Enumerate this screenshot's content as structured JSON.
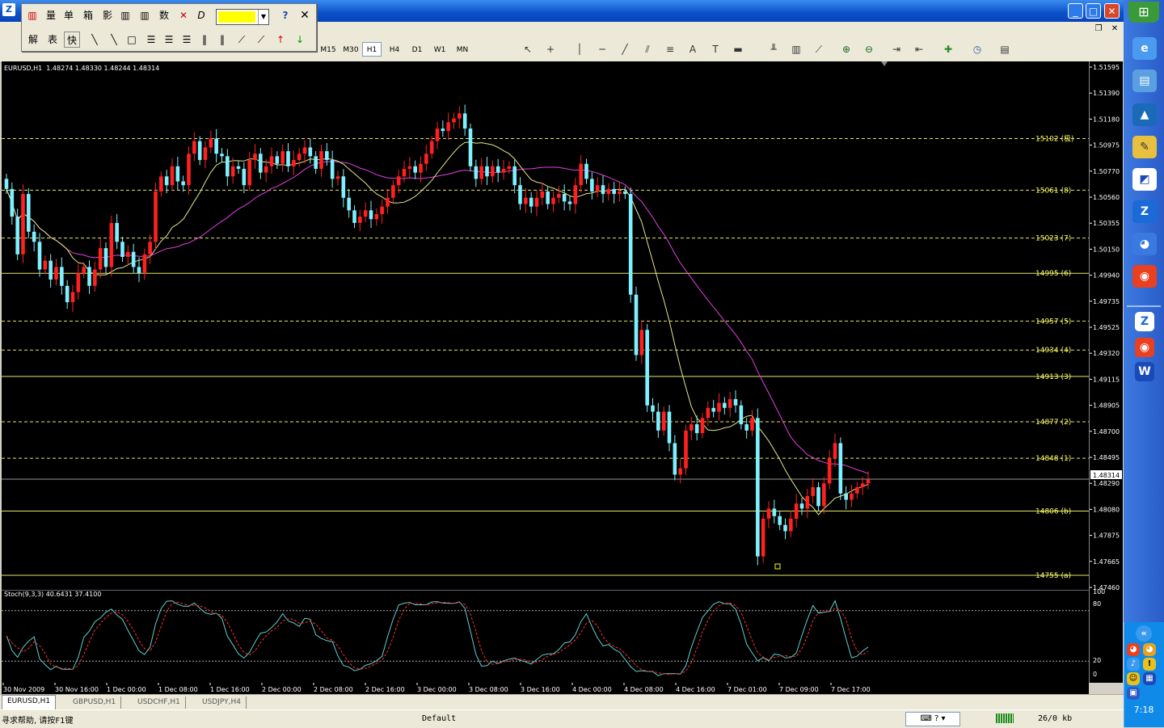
{
  "window": {
    "minimize": "_",
    "maximize": "□",
    "close": "✕",
    "restore_small": "❐",
    "close_small": "✕"
  },
  "float_toolbar": {
    "row1": [
      "量",
      "单",
      "箱",
      "影",
      "数"
    ],
    "row2": [
      "解",
      "表",
      "快"
    ],
    "color_value": ""
  },
  "timeframes": [
    "M15",
    "M30",
    "H1",
    "H4",
    "D1",
    "W1",
    "MN"
  ],
  "active_timeframe": "H1",
  "chart": {
    "header": "EURUSD,H1  1.48274 1.48330 1.48244 1.48314",
    "current_price": "1.48314",
    "price_ticks": [
      "1.51595",
      "1.51390",
      "1.51180",
      "1.50975",
      "1.50770",
      "1.50560",
      "1.50355",
      "1.50150",
      "1.49940",
      "1.49735",
      "1.49525",
      "1.49320",
      "1.49115",
      "1.48905",
      "1.48700",
      "1.48495",
      "1.48290",
      "1.48080",
      "1.47875",
      "1.47665",
      "1.47460"
    ],
    "levels": [
      {
        "label": "15102 (极)",
        "price": 1.5102,
        "style": "dash"
      },
      {
        "label": "15061 (8)",
        "price": 1.5061,
        "style": "dash"
      },
      {
        "label": "15023 (7)",
        "price": 1.5023,
        "style": "dash"
      },
      {
        "label": "14995 (6)",
        "price": 1.4995,
        "style": "solid"
      },
      {
        "label": "14957 (5)",
        "price": 1.4957,
        "style": "dash"
      },
      {
        "label": "14934 (4)",
        "price": 1.4934,
        "style": "dash"
      },
      {
        "label": "14913 (3)",
        "price": 1.4913,
        "style": "solid"
      },
      {
        "label": "14877 (2)",
        "price": 1.4877,
        "style": "dash"
      },
      {
        "label": "14848 (1)",
        "price": 1.4848,
        "style": "dash"
      },
      {
        "label": "14806 (b)",
        "price": 1.4806,
        "style": "solid"
      },
      {
        "label": "14755 (a)",
        "price": 1.4755,
        "style": "solid"
      }
    ],
    "time_labels": [
      "30 Nov 2009",
      "30 Nov 16:00",
      "1 Dec 00:00",
      "1 Dec 08:00",
      "1 Dec 16:00",
      "2 Dec 00:00",
      "2 Dec 08:00",
      "2 Dec 16:00",
      "3 Dec 00:00",
      "3 Dec 08:00",
      "3 Dec 16:00",
      "4 Dec 00:00",
      "4 Dec 08:00",
      "4 Dec 16:00",
      "7 Dec 01:00",
      "7 Dec 09:00",
      "7 Dec 17:00"
    ]
  },
  "stoch": {
    "header": "Stoch(9,3,3) 40.6431 37.4100",
    "ticks": [
      "100",
      "80",
      "20",
      "0"
    ]
  },
  "chart_data": {
    "type": "candlestick",
    "title": "EURUSD,H1",
    "ylim": [
      1.4746,
      1.51595
    ],
    "closes": [
      1.5062,
      1.504,
      1.501,
      1.5058,
      1.5028,
      1.502,
      1.4998,
      1.5005,
      1.499,
      1.5,
      1.4985,
      1.4972,
      1.498,
      1.4995,
      1.5,
      1.4985,
      1.4998,
      1.5015,
      1.5,
      1.5035,
      1.502,
      1.5008,
      1.5012,
      1.5,
      1.4995,
      1.501,
      1.502,
      1.506,
      1.5072,
      1.5065,
      1.508,
      1.5068,
      1.5065,
      1.509,
      1.51,
      1.5085,
      1.5095,
      1.5102,
      1.509,
      1.5088,
      1.5072,
      1.508,
      1.5078,
      1.5065,
      1.5085,
      1.509,
      1.5075,
      1.508,
      1.5088,
      1.5082,
      1.5092,
      1.508,
      1.5085,
      1.509,
      1.5095,
      1.5088,
      1.5078,
      1.5092,
      1.5085,
      1.507,
      1.5072,
      1.5055,
      1.5045,
      1.5035,
      1.504,
      1.5045,
      1.5038,
      1.5042,
      1.5048,
      1.5055,
      1.5065,
      1.5072,
      1.5078,
      1.508,
      1.5075,
      1.5082,
      1.509,
      1.51,
      1.511,
      1.5108,
      1.5115,
      1.5118,
      1.5122,
      1.511,
      1.508,
      1.507,
      1.508,
      1.5072,
      1.508,
      1.5075,
      1.5078,
      1.508,
      1.5065,
      1.505,
      1.5055,
      1.5048,
      1.5055,
      1.506,
      1.505,
      1.5055,
      1.5058,
      1.5052,
      1.505,
      1.5065,
      1.5082,
      1.507,
      1.506,
      1.5065,
      1.5058,
      1.5062,
      1.5058,
      1.506,
      1.5058,
      1.4978,
      1.493,
      1.495,
      1.489,
      1.4885,
      1.487,
      1.4885,
      1.486,
      1.4835,
      1.484,
      1.487,
      1.4875,
      1.4868,
      1.488,
      1.4888,
      1.4885,
      1.4892,
      1.4888,
      1.4895,
      1.489,
      1.4875,
      1.487,
      1.488,
      1.477,
      1.48,
      1.4808,
      1.4802,
      1.4795,
      1.479,
      1.48,
      1.4812,
      1.4808,
      1.4818,
      1.4825,
      1.481,
      1.4828,
      1.4848,
      1.486,
      1.482,
      1.4815,
      1.482,
      1.4825,
      1.4828,
      1.4831
    ]
  }
}
